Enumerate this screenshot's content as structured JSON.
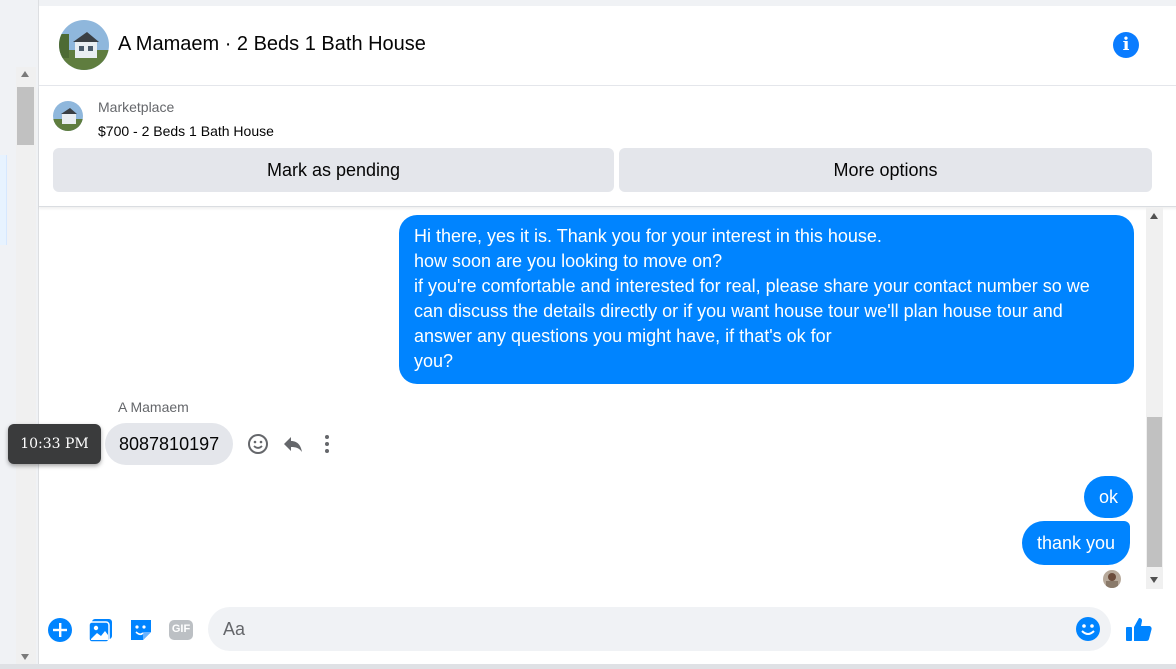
{
  "header": {
    "title": "A Mamaem · 2 Beds 1 Bath House",
    "info_icon": "info-icon"
  },
  "listing": {
    "source": "Marketplace",
    "price_title": "$700 - 2 Beds 1 Bath House",
    "mark_pending_label": "Mark as pending",
    "more_options_label": "More options"
  },
  "messages": {
    "outgoing_first": [
      "Hi there, yes it is. Thank you for your interest in this house.",
      "how soon are you looking to move on?",
      "if you're comfortable and interested for real, please share your contact number so we",
      "can discuss the details directly or if you want house tour we'll plan house tour and",
      "answer any questions you might have, if that's ok for",
      "you?"
    ],
    "incoming_sender": "A Mamaem",
    "incoming_text": "8087810197",
    "tooltip_time": "10:33 PM",
    "outgoing_ok": "ok",
    "outgoing_thanks": "thank you"
  },
  "composer": {
    "placeholder": "Aa",
    "gif_label": "GIF"
  },
  "colors": {
    "accent": "#0084ff",
    "incoming_bubble": "#e4e6eb",
    "button_bg": "#e4e6eb"
  }
}
